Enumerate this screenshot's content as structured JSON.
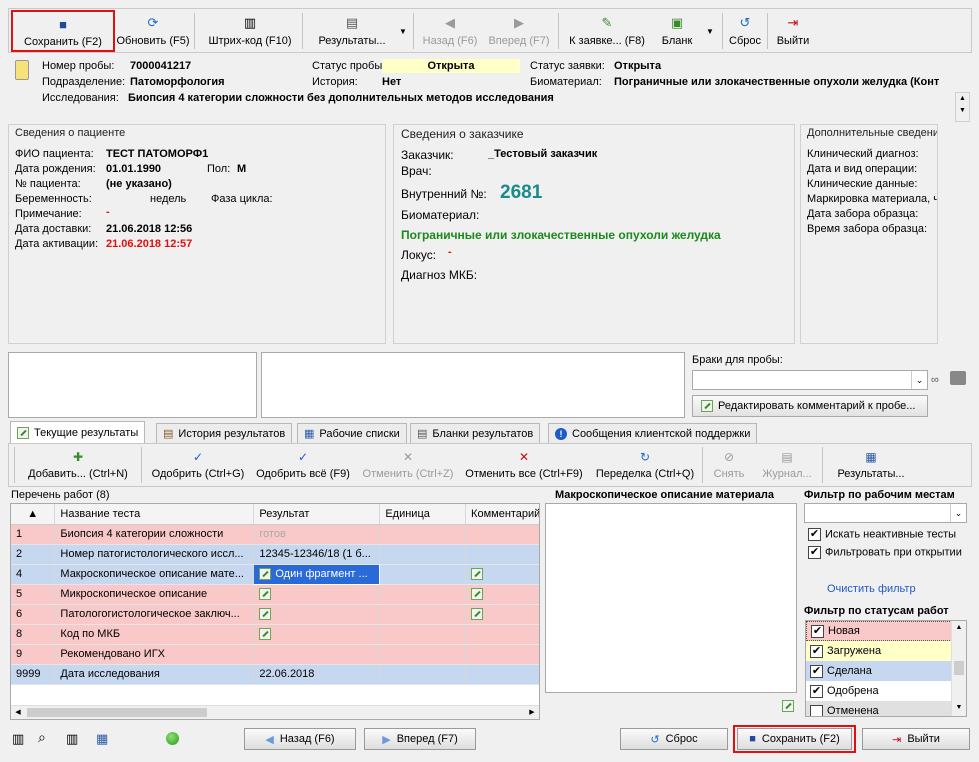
{
  "toolbar": {
    "save": "Сохранить (F2)",
    "refresh": "Обновить (F5)",
    "barcode": "Штрих-код (F10)",
    "results": "Результаты...",
    "back": "Назад (F6)",
    "forward": "Вперед (F7)",
    "to_order": "К заявке... (F8)",
    "form": "Бланк",
    "reset": "Сброс",
    "exit": "Выйти"
  },
  "sample": {
    "number_label": "Номер пробы:",
    "number": "7000041217",
    "department_label": "Подразделение:",
    "department": "Патоморфология",
    "study_label": "Исследования:",
    "study": "Биопсия 4 категории сложности без дополнительных методов исследования",
    "status_label": "Статус пробы:",
    "status": "Открыта",
    "history_label": "История:",
    "history": "Нет",
    "order_status_label": "Статус заявки:",
    "order_status": "Открыта",
    "biomaterial_label": "Биоматериал:",
    "biomaterial": "Пограничные или злокачественные опухоли желудка (Конт"
  },
  "patient": {
    "header": "Сведения о пациенте",
    "fio_label": "ФИО пациента:",
    "fio": "ТЕСТ ПАТОМОРФ1",
    "dob_label": "Дата рождения:",
    "dob": "01.01.1990",
    "sex_label": "Пол:",
    "sex": "М",
    "num_label": "№ пациента:",
    "num": "(не указано)",
    "preg_label": "Беременность:",
    "preg_unit": "недель",
    "cycle_label": "Фаза цикла:",
    "note_label": "Примечание:",
    "note": "-",
    "delivery_label": "Дата доставки:",
    "delivery": "21.06.2018 12:56",
    "activation_label": "Дата активации:",
    "activation": "21.06.2018 12:57"
  },
  "customer": {
    "header": "Сведения о заказчике",
    "customer_label": "Заказчик:",
    "customer": "_Тестовый заказчик",
    "doctor_label": "Врач:",
    "internal_label": "Внутренний №:",
    "internal": "2681",
    "bio_label": "Биоматериал:",
    "bio": "Пограничные или злокачественные опухоли желудка",
    "locus_label": "Локус:",
    "locus": "-",
    "mkb_label": "Диагноз МКБ:"
  },
  "extra": {
    "header": "Дополнительные сведени",
    "items": [
      "Клинический диагноз:",
      "Дата и вид операции:",
      "Клинические данные:",
      "Маркировка материала, ч",
      "Дата забора образца:",
      "Время забора образца:"
    ]
  },
  "defects": {
    "label": "Браки для пробы:",
    "edit_button": "Редактировать комментарий к пробе..."
  },
  "tabs": [
    "Текущие результаты",
    "История результатов",
    "Рабочие списки",
    "Бланки результатов",
    "Сообщения клиентской поддержки"
  ],
  "grid_toolbar": {
    "add": "Добавить... (Ctrl+N)",
    "approve": "Одобрить (Ctrl+G)",
    "approve_all": "Одобрить всё (F9)",
    "cancel": "Отменить (Ctrl+Z)",
    "cancel_all": "Отменить все (Ctrl+F9)",
    "rework": "Переделка (Ctrl+Q)",
    "remove": "Снять",
    "journal": "Журнал...",
    "results": "Результаты..."
  },
  "worklist": {
    "title": "Перечень работ (8)",
    "columns": [
      "Название теста",
      "Результат",
      "Единица",
      "Комментарий"
    ],
    "rows": [
      {
        "n": "1",
        "name": "Биопсия 4 категории сложности",
        "result": "готов"
      },
      {
        "n": "2",
        "name": "Номер патогистологического иссл...",
        "result": "12345-12346/18 (1 б..."
      },
      {
        "n": "4",
        "name": "Макроскопическое описание мате...",
        "result": "Один фрагмент ..."
      },
      {
        "n": "5",
        "name": "Микроскопическое описание",
        "result": ""
      },
      {
        "n": "6",
        "name": "Патологогистологическое заключ...",
        "result": ""
      },
      {
        "n": "8",
        "name": "Код по МКБ",
        "result": ""
      },
      {
        "n": "9",
        "name": "Рекомендовано ИГХ",
        "result": ""
      },
      {
        "n": "9999",
        "name": "Дата исследования",
        "result": "22.06.2018"
      }
    ]
  },
  "macro_header": "Макроскопическое описание материала",
  "filter": {
    "workplace_header": "Фильтр по рабочим местам",
    "inactive": "Искать неактивные тесты",
    "on_open": "Фильтровать при открытии",
    "clear": "Очистить фильтр",
    "status_header": "Фильтр по статусам работ",
    "statuses": [
      "Новая",
      "Загружена",
      "Сделана",
      "Одобрена",
      "Отменена"
    ]
  },
  "bottom": {
    "back": "Назад (F6)",
    "forward": "Вперед (F7)",
    "reset": "Сброс",
    "save": "Сохранить (F2)",
    "exit": "Выйти"
  }
}
